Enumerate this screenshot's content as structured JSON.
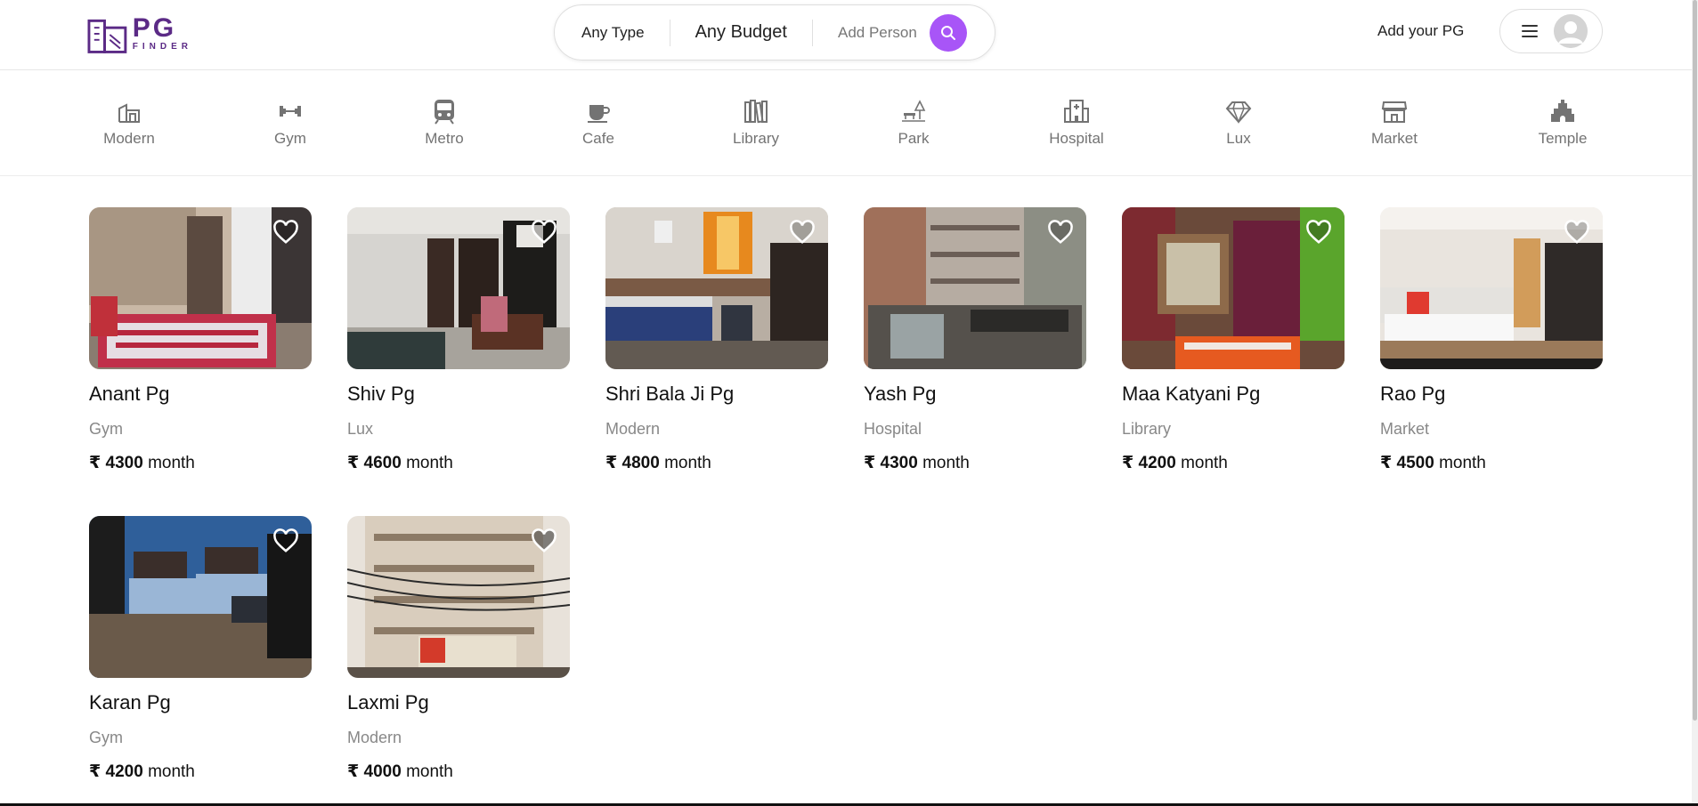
{
  "header": {
    "logo_main": "PG",
    "logo_sub": "FINDER",
    "search": {
      "type_label": "Any Type",
      "budget_label": "Any Budget",
      "person_label": "Add Person",
      "button_icon": "search-icon"
    },
    "add_pg_label": "Add your PG",
    "menu_icon": "hamburger-icon",
    "avatar_icon": "user-avatar-icon"
  },
  "theme": {
    "accent": "#a855f7",
    "brand": "#5b2a86",
    "muted_text": "#737373"
  },
  "categories": [
    {
      "label": "Modern",
      "icon": "modern-building-icon"
    },
    {
      "label": "Gym",
      "icon": "dumbbell-icon"
    },
    {
      "label": "Metro",
      "icon": "metro-train-icon"
    },
    {
      "label": "Cafe",
      "icon": "coffee-cup-icon"
    },
    {
      "label": "Library",
      "icon": "books-icon"
    },
    {
      "label": "Park",
      "icon": "park-icon"
    },
    {
      "label": "Hospital",
      "icon": "hospital-icon"
    },
    {
      "label": "Lux",
      "icon": "diamond-icon"
    },
    {
      "label": "Market",
      "icon": "store-icon"
    },
    {
      "label": "Temple",
      "icon": "temple-icon"
    }
  ],
  "listings": [
    {
      "name": "Anant Pg",
      "category": "Gym",
      "price": "₹ 4300",
      "unit": "month",
      "favorited": false
    },
    {
      "name": "Shiv Pg",
      "category": "Lux",
      "price": "₹ 4600",
      "unit": "month",
      "favorited": false
    },
    {
      "name": "Shri Bala Ji Pg",
      "category": "Modern",
      "price": "₹ 4800",
      "unit": "month",
      "favorited": false
    },
    {
      "name": "Yash Pg",
      "category": "Hospital",
      "price": "₹ 4300",
      "unit": "month",
      "favorited": false
    },
    {
      "name": "Maa Katyani Pg",
      "category": "Library",
      "price": "₹ 4200",
      "unit": "month",
      "favorited": false
    },
    {
      "name": "Rao Pg",
      "category": "Market",
      "price": "₹ 4500",
      "unit": "month",
      "favorited": false
    },
    {
      "name": "Karan Pg",
      "category": "Gym",
      "price": "₹ 4200",
      "unit": "month",
      "favorited": false
    },
    {
      "name": "Laxmi Pg",
      "category": "Modern",
      "price": "₹ 4000",
      "unit": "month",
      "favorited": false
    }
  ]
}
